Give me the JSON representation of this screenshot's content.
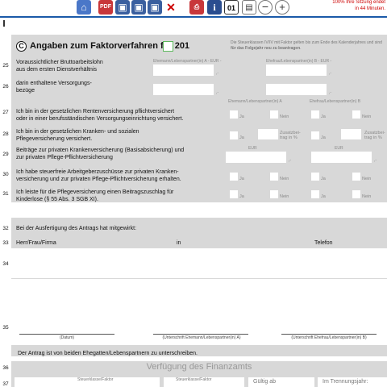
{
  "toolbar": {
    "session_line1": "100% Ihre Sitzung endet",
    "session_line2": "in 44 Minuten.",
    "icons": [
      "home-icon",
      "pdf-icon",
      "save-icon",
      "save-as-icon",
      "download-icon",
      "delete-icon",
      "print-icon",
      "info-icon",
      "calendar-icon",
      "page-icon",
      "zoom-out-icon",
      "zoom-in-icon"
    ],
    "calendar_text": "01",
    "accent_color": "#1b5aa8"
  },
  "section_c": {
    "letter": "C",
    "title": "Angaben zum Faktorverfahren für 201",
    "note_line1": "Die Steuerklassen IV/IV mit Faktor gelten bis zum Ende des Kalenderjahres",
    "note_line2a": "und sind ",
    "note_line2b": "für das Folgejahr neu zu beantragen",
    "note_line2c": ".",
    "col_a": "Ehemann/Lebenspartner(in) A - EUR -",
    "col_b": "Ehefrau/Lebenspartner(in) B - EUR -",
    "col_a_short": "Ehemann/Lebenspartner(in) A",
    "col_b_short": "Ehefrau/Lebenspartner(in) B",
    "eur": "EUR",
    "ja": "Ja",
    "nein": "Nein",
    "zusatz_1": "Zusatzbei-",
    "zusatz_2": "trag in %",
    "rows": [
      {
        "num": "25",
        "line1": "Voraussichtlicher Bruttoarbeitslohn",
        "line2": "aus dem ersten Dienstverhältnis"
      },
      {
        "num": "26",
        "line1": "darin enthaltene Versorgungs-",
        "line2": "bezüge"
      },
      {
        "num": "27",
        "line1": "Ich bin in der gesetzlichen Rentenversicherung pflichtversichert",
        "line2": "oder in einer berufsständischen Versorgungseinrichtung versichert."
      },
      {
        "num": "28",
        "line1": "Ich bin in der gesetzlichen Kranken- und sozialen",
        "line2": "Pflegeversicherung versichert."
      },
      {
        "num": "29",
        "line1": "Beiträge zur privaten Krankenversicherung (Basisabsicherung) und",
        "line2": "zur privaten Pflege-Pflichtversicherung"
      },
      {
        "num": "30",
        "line1": "Ich habe steuerfreie Arbeitgeberzuschüsse zur privaten Kranken-",
        "line2": "versicherung und zur privaten Pflege-Pflichtversicherung erhalten."
      },
      {
        "num": "31",
        "line1": "Ich leiste für die Pflegeversicherung einen Beitragszuschlag für",
        "line2": "Kinderlose (§ 55 Abs. 3 SGB XI)."
      }
    ]
  },
  "mitwirkung": {
    "num_32": "32",
    "num_33": "33",
    "num_34": "34",
    "num_35": "35",
    "num_36": "36",
    "num_37": "37",
    "intro": "Bei der Ausfertigung des Antrags hat mitgewirkt:",
    "col_name": "Herr/Frau/Firma",
    "col_in": "in",
    "col_tel": "Telefon",
    "sig_datum": "(Datum)",
    "sig_a": "(Unterschrift Ehemann/Lebenspartner(in) A)",
    "sig_b": "(Unterschrift Ehefrau/Lebenspartner(in) B)",
    "note": "Der Antrag ist von beiden Ehegatten/Lebenspartnern zu unterschreiben."
  },
  "finanzamt": {
    "title": "Verfügung des Finanzamts",
    "col1": "Steuerklasse/Faktor",
    "col2": "Steuerklasse/Faktor",
    "col3": "Gültig ab",
    "col4": "Im Trennungsjahr:"
  }
}
